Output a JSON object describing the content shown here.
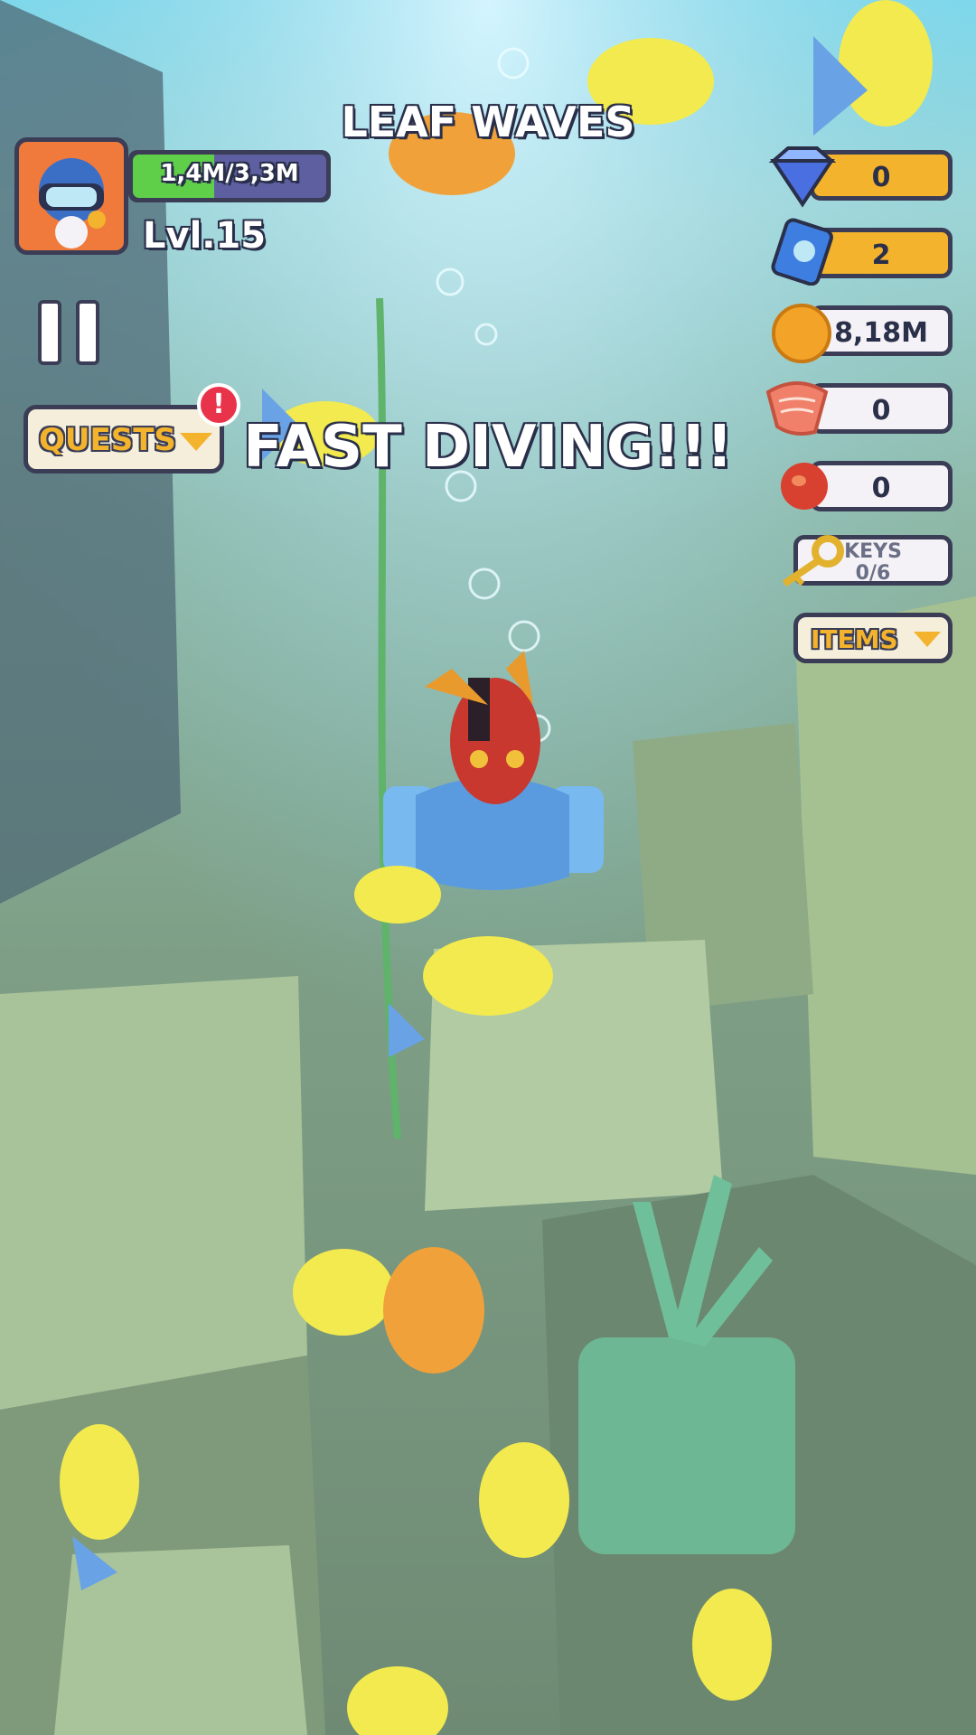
{
  "hud": {
    "level_name": "LEAF WAVES",
    "banner": "FAST DIVING!!!",
    "player": {
      "xp_text": "1,4M/3,3M",
      "xp_progress": 0.42,
      "level": "Lvl.15"
    }
  },
  "quests": {
    "label": "QUESTS",
    "alert": "!"
  },
  "resources": {
    "gems": "0",
    "tickets": "2",
    "coins": "8,18M",
    "salmon": "0",
    "berries": "0",
    "keys_label": "KEYS",
    "keys_value": "0/6"
  },
  "items": {
    "label": "ITEMS"
  },
  "colors": {
    "accent_gold": "#f3b32c",
    "outline": "#3a3d55",
    "xp_green": "#5fcf4a",
    "alert_red": "#e8334a"
  },
  "icons": [
    "diver-avatar-icon",
    "pause-icon",
    "chevron-down-icon",
    "gem-icon",
    "ticket-icon",
    "coin-icon",
    "salmon-icon",
    "berry-icon",
    "key-icon"
  ]
}
